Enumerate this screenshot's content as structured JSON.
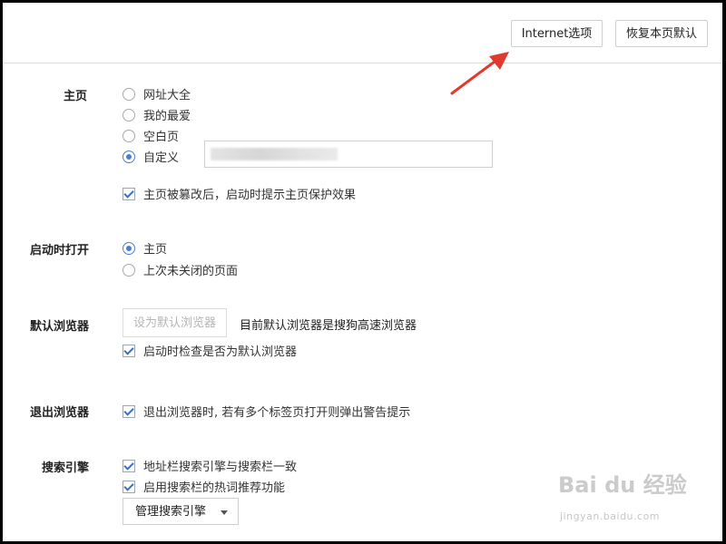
{
  "colors": {
    "accent": "#4a7fd0",
    "arrow": "#e03a2f",
    "border": "#cfcfcf"
  },
  "toolbar": {
    "internet_options_label": "Internet选项",
    "restore_defaults_label": "恢复本页默认"
  },
  "homepage": {
    "label": "主页",
    "options": [
      "网址大全",
      "我的最爱",
      "空白页",
      "自定义"
    ],
    "selected": "自定义",
    "protect_checkbox": "主页被篡改后，启动时提示主页保护效果"
  },
  "startup": {
    "label": "启动时打开",
    "options": [
      "主页",
      "上次未关闭的页面"
    ],
    "selected": "主页"
  },
  "default_browser": {
    "label": "默认浏览器",
    "set_default_button": "设为默认浏览器",
    "status_text": "目前默认浏览器是搜狗高速浏览器",
    "check_on_startup": "启动时检查是否为默认浏览器"
  },
  "exit_browser": {
    "label": "退出浏览器",
    "warn_checkbox": "退出浏览器时, 若有多个标签页打开则弹出警告提示"
  },
  "search_engine": {
    "label": "搜索引擎",
    "sync_checkbox": "地址栏搜索引擎与搜索栏一致",
    "hot_words_checkbox": "启用搜索栏的热词推荐功能",
    "manage_button": "管理搜索引擎"
  },
  "watermark": {
    "brand": "Bai du 经验",
    "sub": "jingyan.baidu.com"
  }
}
